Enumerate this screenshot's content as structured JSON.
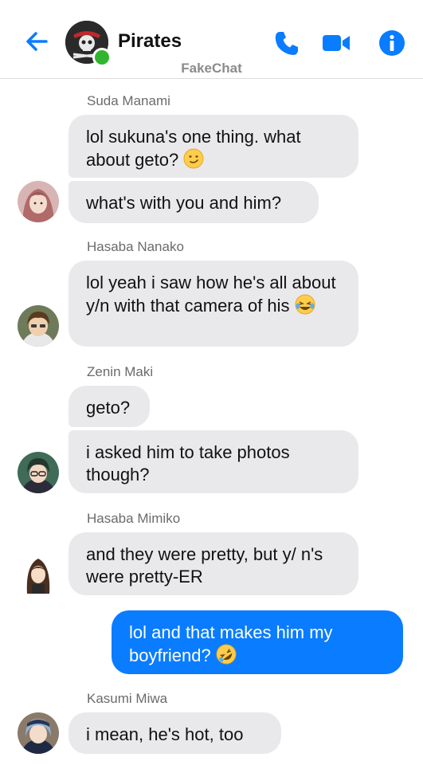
{
  "header": {
    "title": "Pirates",
    "subtitle": "FakeChat",
    "colors": {
      "accent": "#0a7cff",
      "online": "#31b52e"
    }
  },
  "messages": {
    "suda": {
      "sender": "Suda Manami",
      "m1": "lol sukuna's one thing. what about geto?",
      "m2": "what's with you and him?"
    },
    "hasaba_nanako": {
      "sender": "Hasaba Nanako",
      "m1": "lol yeah i saw how he's all about y/n with that camera of his"
    },
    "zenin": {
      "sender": "Zenin Maki",
      "m1": "geto?",
      "m2": "i asked him to take photos though?"
    },
    "hasaba_mimiko": {
      "sender": "Hasaba Mimiko",
      "m1": "and they were pretty, but y/ n's were pretty-ER"
    },
    "me": {
      "m1": "lol and that makes him my boyfriend?"
    },
    "kasumi": {
      "sender": "Kasumi Miwa",
      "m1": "i mean, he's hot, too"
    }
  }
}
